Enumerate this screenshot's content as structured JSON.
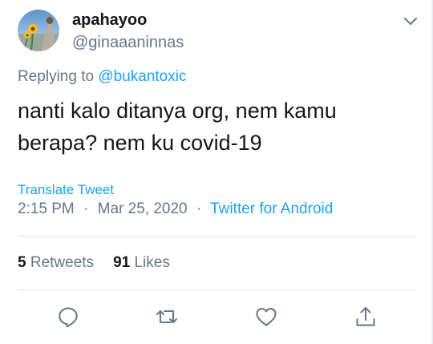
{
  "author": {
    "display_name": "apahayoo",
    "handle": "@ginaaaninnas"
  },
  "reply": {
    "prefix": "Replying to",
    "mention": "@bukantoxic"
  },
  "tweet": {
    "text": "nanti kalo ditanya org, nem kamu berapa? nem ku covid-19",
    "translate_label": "Translate Tweet",
    "time": "2:15 PM",
    "date": "Mar 25, 2020",
    "separator": "·",
    "client": "Twitter for Android"
  },
  "stats": {
    "retweets_count": "5",
    "retweets_label": "Retweets",
    "likes_count": "91",
    "likes_label": "Likes"
  },
  "icons": {
    "menu": "chevron-down-icon",
    "reply": "reply-icon",
    "retweet": "retweet-icon",
    "like": "heart-icon",
    "share": "share-icon"
  },
  "colors": {
    "link": "#1da1f2",
    "muted": "#657786",
    "text": "#14171a",
    "divider": "#e1e8ed"
  }
}
